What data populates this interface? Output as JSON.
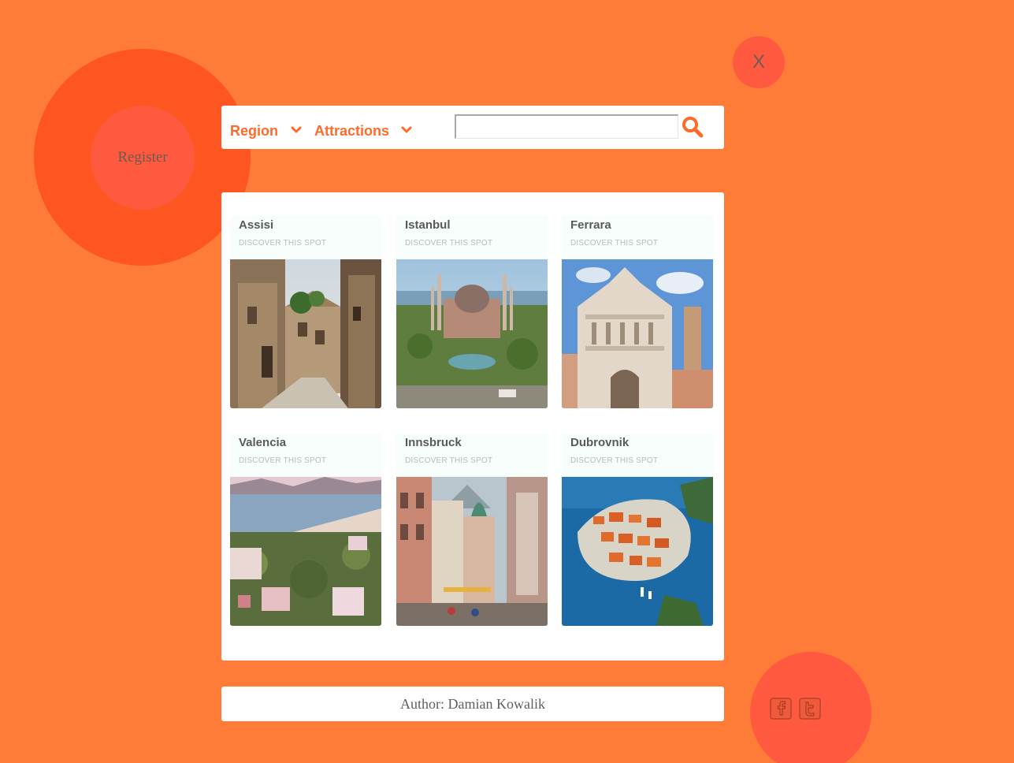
{
  "register": {
    "label": "Register"
  },
  "close": {
    "label": "X"
  },
  "nav": {
    "region_label": "Region",
    "attractions_label": "Attractions",
    "search_value": "",
    "accent": "#ff6a2a"
  },
  "cards": [
    {
      "title": "Assisi",
      "subtitle": "DISCOVER THIS SPOT"
    },
    {
      "title": "Istanbul",
      "subtitle": "DISCOVER THIS SPOT"
    },
    {
      "title": "Ferrara",
      "subtitle": "DISCOVER THIS SPOT"
    },
    {
      "title": "Valencia",
      "subtitle": "DISCOVER THIS SPOT"
    },
    {
      "title": "Innsbruck",
      "subtitle": "DISCOVER THIS SPOT"
    },
    {
      "title": "Dubrovnik",
      "subtitle": "DISCOVER THIS SPOT"
    }
  ],
  "footer": {
    "author_text": "Author: Damian Kowalik"
  },
  "social": [
    "facebook-icon",
    "twitter-icon"
  ],
  "colors": {
    "background": "#ff7b38",
    "circle_dark": "#ff5520",
    "circle_light": "#ff5a40"
  }
}
